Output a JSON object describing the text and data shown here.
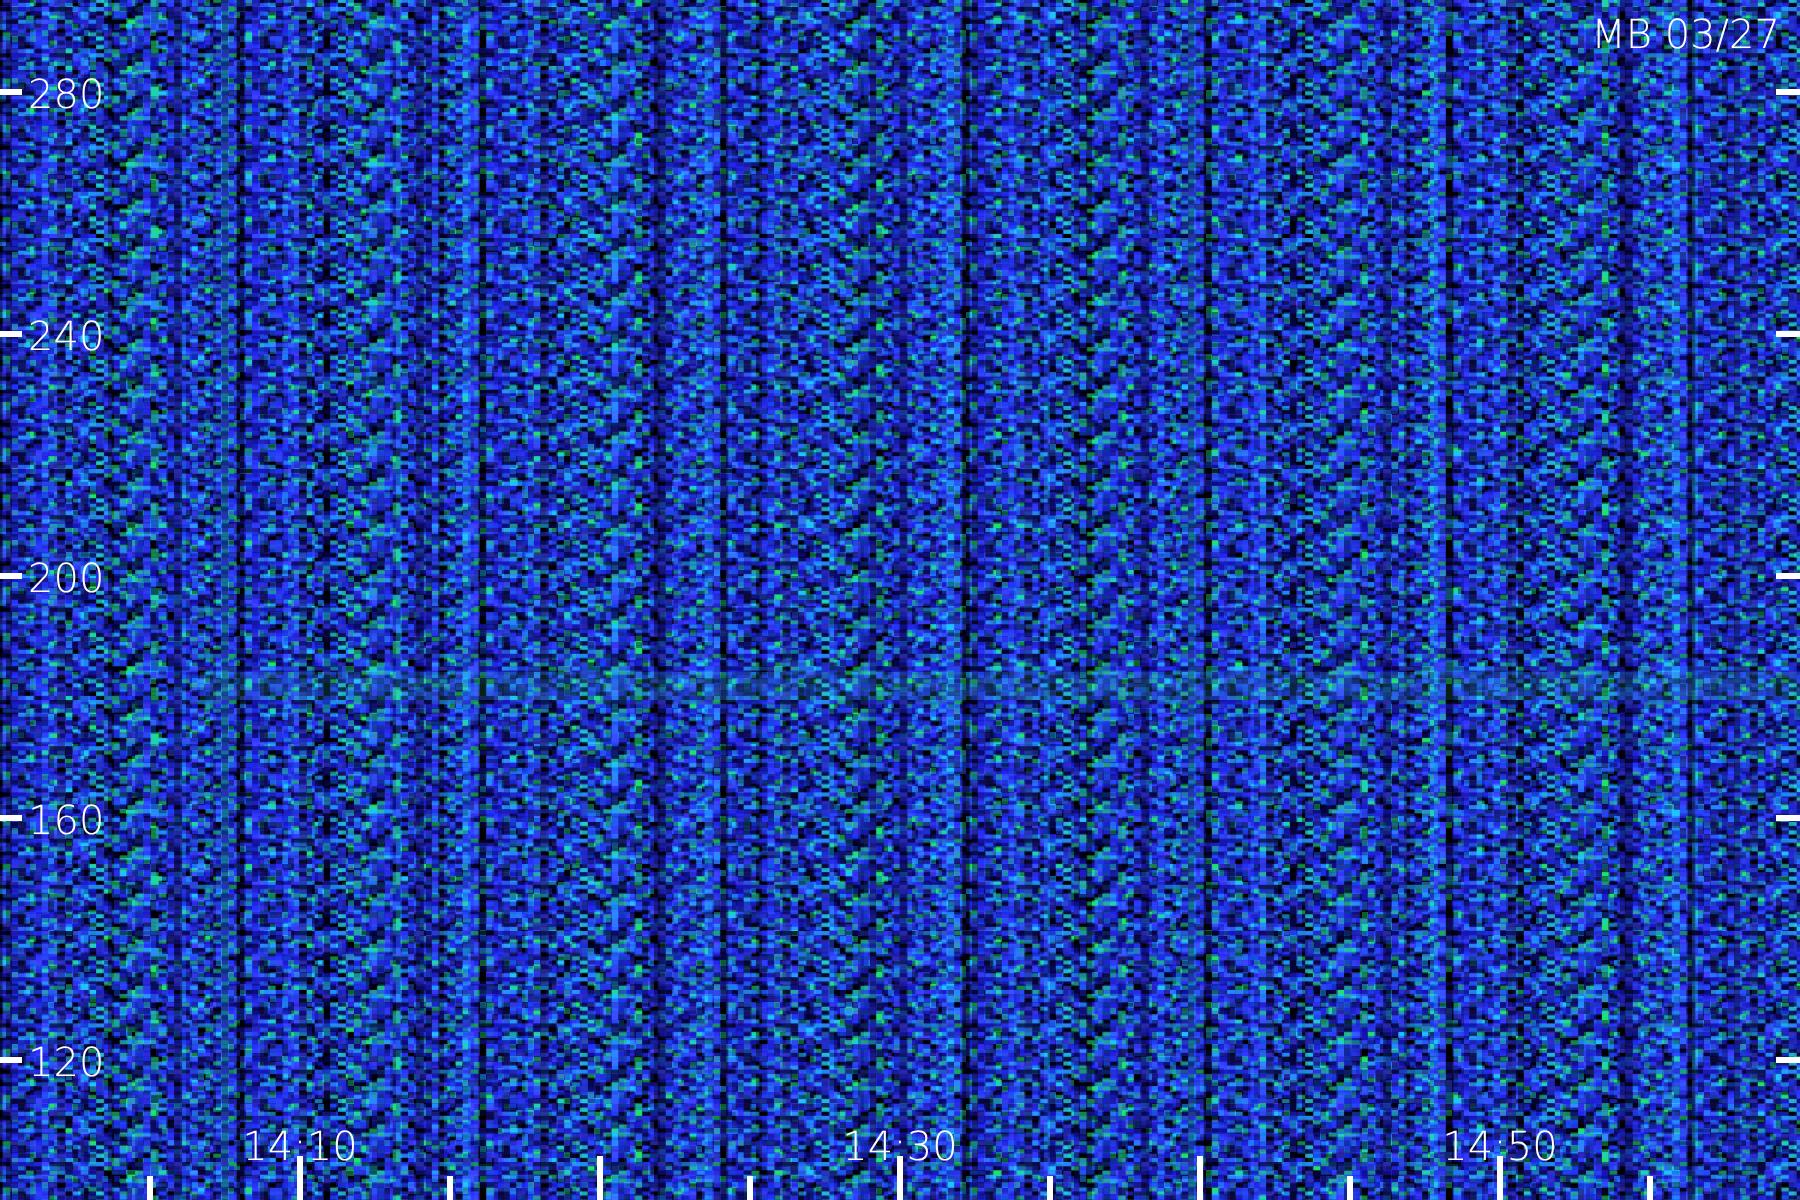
{
  "plot": {
    "label": "MB 03/27",
    "y_ticks": [
      "280",
      "240",
      "200",
      "160",
      "120"
    ],
    "x_ticks": [
      "14:10",
      "14:30",
      "14:50"
    ]
  }
}
